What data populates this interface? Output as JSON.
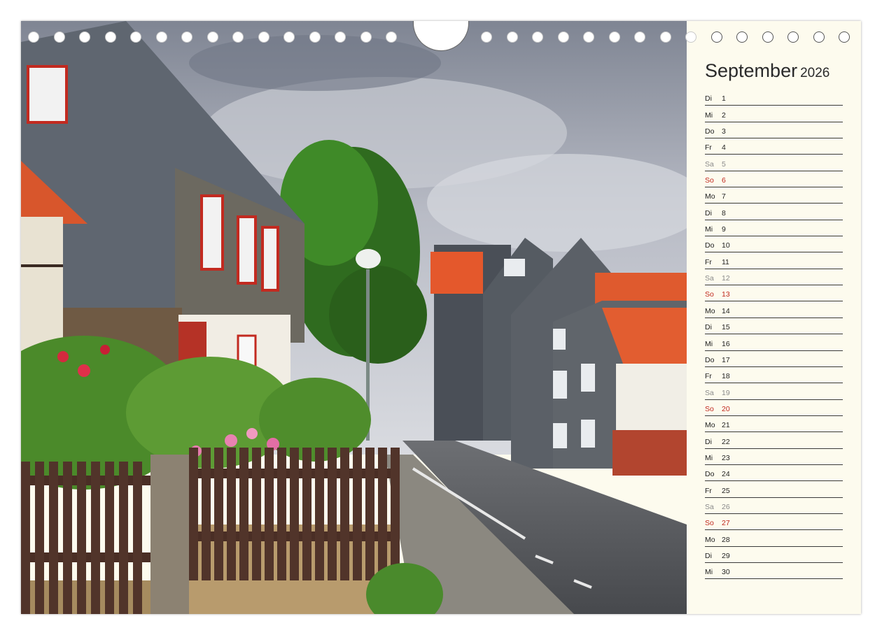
{
  "calendar": {
    "month": "September",
    "year": "2026",
    "days": [
      {
        "weekday": "Di",
        "day": "1",
        "type": "weekday"
      },
      {
        "weekday": "Mi",
        "day": "2",
        "type": "weekday"
      },
      {
        "weekday": "Do",
        "day": "3",
        "type": "weekday"
      },
      {
        "weekday": "Fr",
        "day": "4",
        "type": "weekday"
      },
      {
        "weekday": "Sa",
        "day": "5",
        "type": "saturday"
      },
      {
        "weekday": "So",
        "day": "6",
        "type": "sunday"
      },
      {
        "weekday": "Mo",
        "day": "7",
        "type": "weekday"
      },
      {
        "weekday": "Di",
        "day": "8",
        "type": "weekday"
      },
      {
        "weekday": "Mi",
        "day": "9",
        "type": "weekday"
      },
      {
        "weekday": "Do",
        "day": "10",
        "type": "weekday"
      },
      {
        "weekday": "Fr",
        "day": "11",
        "type": "weekday"
      },
      {
        "weekday": "Sa",
        "day": "12",
        "type": "saturday"
      },
      {
        "weekday": "So",
        "day": "13",
        "type": "sunday"
      },
      {
        "weekday": "Mo",
        "day": "14",
        "type": "weekday"
      },
      {
        "weekday": "Di",
        "day": "15",
        "type": "weekday"
      },
      {
        "weekday": "Mi",
        "day": "16",
        "type": "weekday"
      },
      {
        "weekday": "Do",
        "day": "17",
        "type": "weekday"
      },
      {
        "weekday": "Fr",
        "day": "18",
        "type": "weekday"
      },
      {
        "weekday": "Sa",
        "day": "19",
        "type": "saturday"
      },
      {
        "weekday": "So",
        "day": "20",
        "type": "sunday"
      },
      {
        "weekday": "Mo",
        "day": "21",
        "type": "weekday"
      },
      {
        "weekday": "Di",
        "day": "22",
        "type": "weekday"
      },
      {
        "weekday": "Mi",
        "day": "23",
        "type": "weekday"
      },
      {
        "weekday": "Do",
        "day": "24",
        "type": "weekday"
      },
      {
        "weekday": "Fr",
        "day": "25",
        "type": "weekday"
      },
      {
        "weekday": "Sa",
        "day": "26",
        "type": "saturday"
      },
      {
        "weekday": "So",
        "day": "27",
        "type": "sunday"
      },
      {
        "weekday": "Mo",
        "day": "28",
        "type": "weekday"
      },
      {
        "weekday": "Di",
        "day": "29",
        "type": "weekday"
      },
      {
        "weekday": "Mi",
        "day": "30",
        "type": "weekday"
      }
    ]
  },
  "colors": {
    "sunday": "#c0281e",
    "saturday": "#8a8a8a",
    "paper": "#fdfbee"
  }
}
